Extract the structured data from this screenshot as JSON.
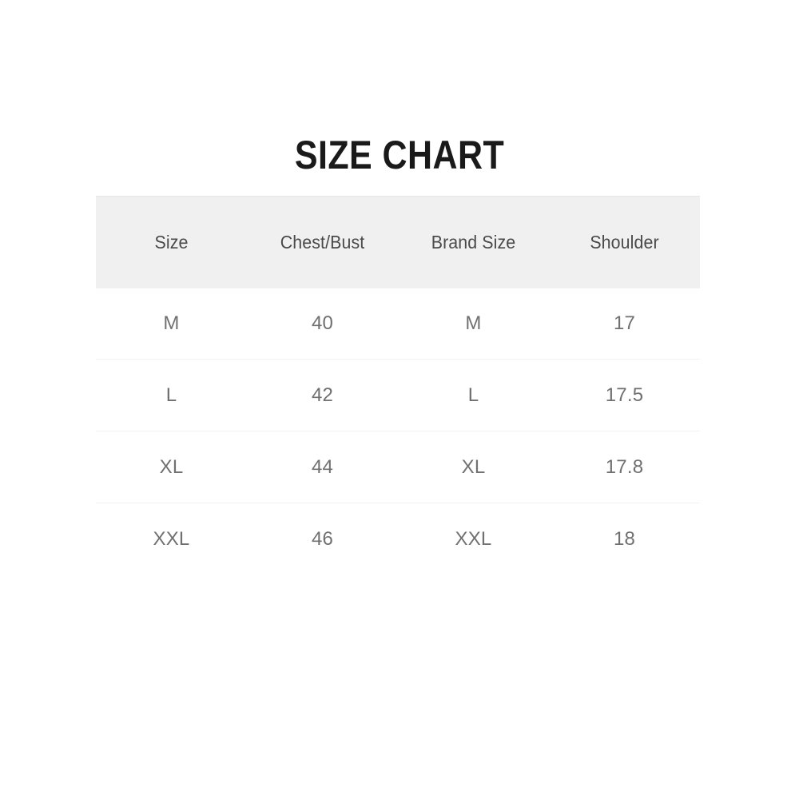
{
  "page": {
    "background_color": "#ffffff"
  },
  "title": {
    "text": "SIZE CHART",
    "color": "#1a1a1a"
  },
  "table": {
    "header_background_color": "#f0f0f0",
    "header_text_color": "#4a4a4a",
    "body_text_color": "#707070",
    "row_divider_color": "#f2f2f2",
    "columns": [
      {
        "key": "size",
        "label": "Size"
      },
      {
        "key": "chest_bust",
        "label": "Chest/Bust"
      },
      {
        "key": "brand_size",
        "label": "Brand Size"
      },
      {
        "key": "shoulder",
        "label": "Shoulder"
      }
    ],
    "rows": [
      {
        "size": "M",
        "chest_bust": "40",
        "brand_size": "M",
        "shoulder": "17"
      },
      {
        "size": "L",
        "chest_bust": "42",
        "brand_size": "L",
        "shoulder": "17.5"
      },
      {
        "size": "XL",
        "chest_bust": "44",
        "brand_size": "XL",
        "shoulder": "17.8"
      },
      {
        "size": "XXL",
        "chest_bust": "46",
        "brand_size": "XXL",
        "shoulder": "18"
      }
    ]
  },
  "chart_data": {
    "type": "table",
    "title": "SIZE CHART",
    "columns": [
      "Size",
      "Chest/Bust",
      "Brand Size",
      "Shoulder"
    ],
    "rows": [
      [
        "M",
        "40",
        "M",
        "17"
      ],
      [
        "L",
        "42",
        "L",
        "17.5"
      ],
      [
        "XL",
        "44",
        "XL",
        "17.8"
      ],
      [
        "XXL",
        "46",
        "XXL",
        "18"
      ]
    ]
  }
}
